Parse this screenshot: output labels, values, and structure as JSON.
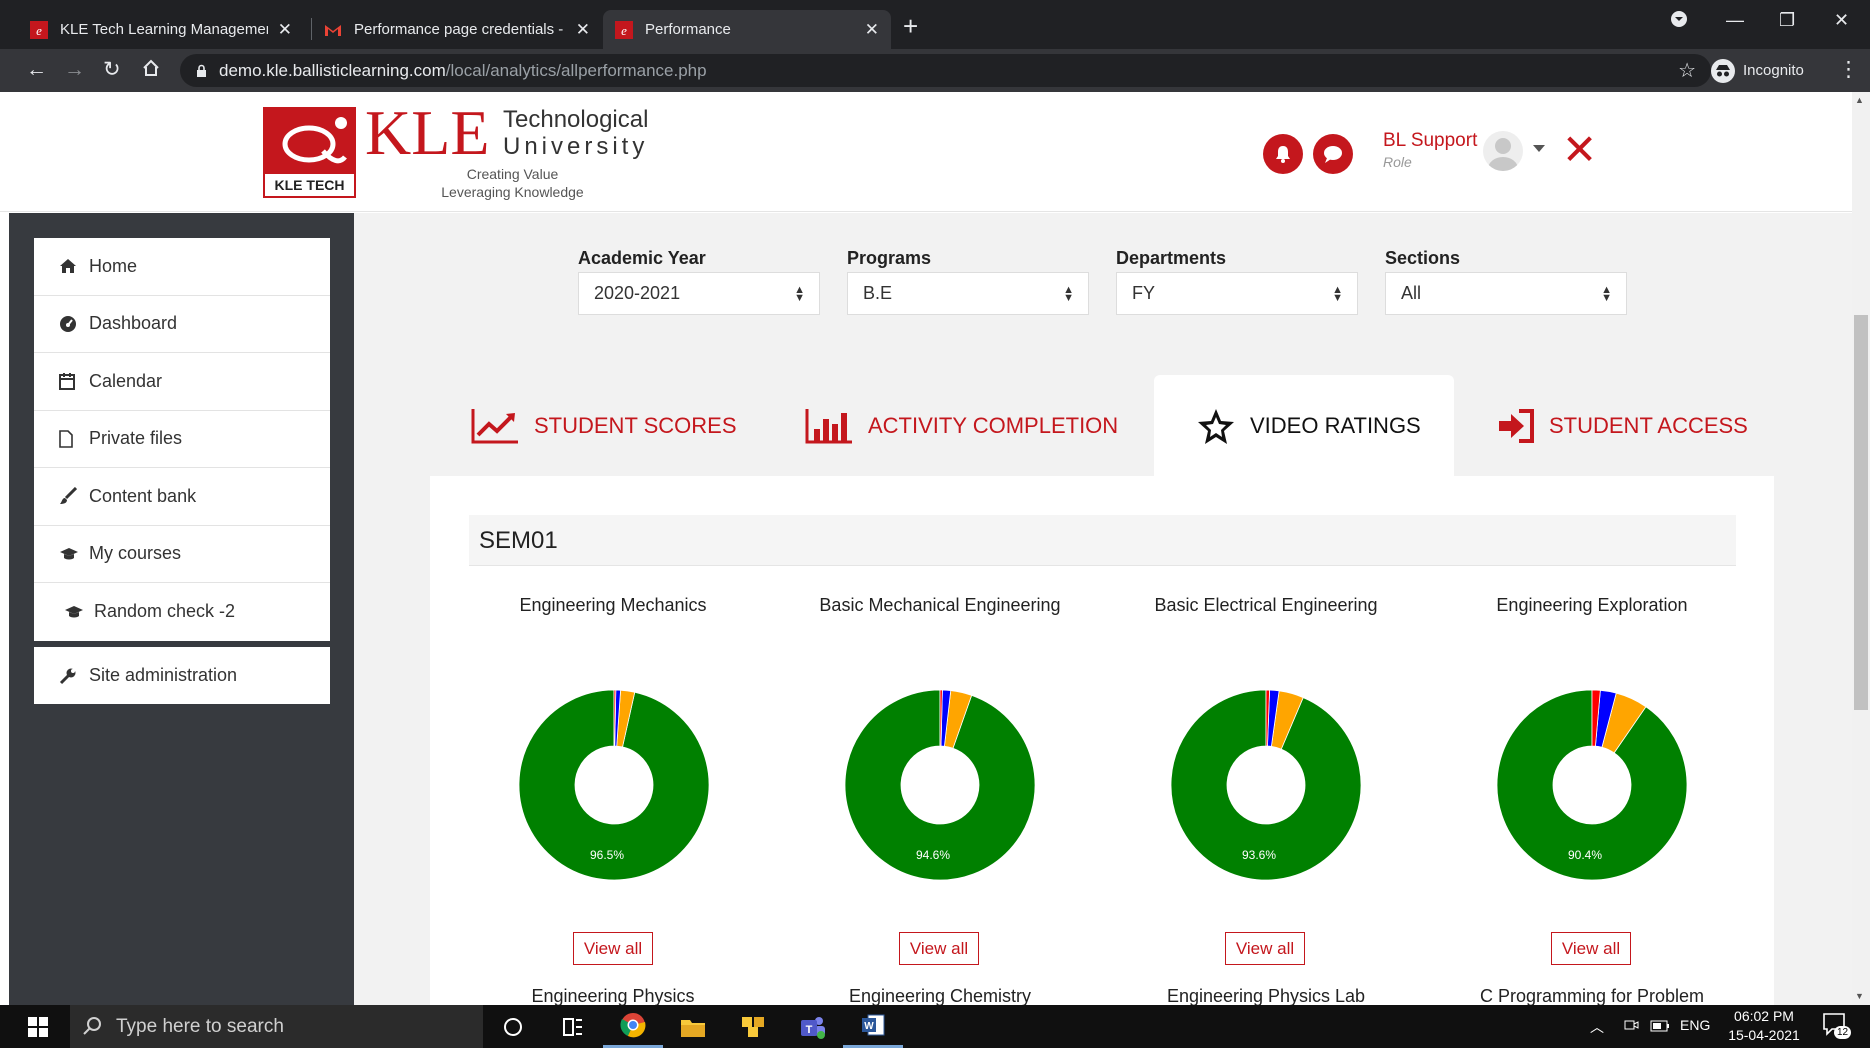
{
  "browser": {
    "tabs": [
      {
        "title": "KLE Tech Learning Management S",
        "active": false
      },
      {
        "title": "Performance page credentials - u",
        "active": false
      },
      {
        "title": "Performance",
        "active": true
      }
    ],
    "url_host": "demo.kle.ballisticlearning.com",
    "url_path": "/local/analytics/allperformance.php",
    "incognito_label": "Incognito"
  },
  "header": {
    "logo_badge": "KLE TECH",
    "logo_kle": "KLE",
    "logo_line1": "Technological",
    "logo_line2": "University",
    "tagline1": "Creating Value",
    "tagline2": "Leveraging Knowledge",
    "user_name": "BL Support",
    "user_role": "Role"
  },
  "sidebar": {
    "items": [
      {
        "label": "Home",
        "icon": "home-icon"
      },
      {
        "label": "Dashboard",
        "icon": "dashboard-icon"
      },
      {
        "label": "Calendar",
        "icon": "calendar-icon"
      },
      {
        "label": "Private files",
        "icon": "file-icon"
      },
      {
        "label": "Content bank",
        "icon": "brush-icon"
      },
      {
        "label": "My courses",
        "icon": "graduation-cap-icon"
      },
      {
        "label": "Random check -2",
        "icon": "graduation-cap-icon"
      }
    ],
    "admin": {
      "label": "Site administration",
      "icon": "wrench-icon"
    }
  },
  "filters": {
    "academic_year": {
      "label": "Academic Year",
      "value": "2020-2021"
    },
    "programs": {
      "label": "Programs",
      "value": "B.E"
    },
    "departments": {
      "label": "Departments",
      "value": "FY"
    },
    "sections": {
      "label": "Sections",
      "value": "All"
    }
  },
  "tabs": [
    {
      "label": "STUDENT SCORES",
      "icon": "line-chart-icon",
      "active": false
    },
    {
      "label": "ACTIVITY COMPLETION",
      "icon": "bar-chart-icon",
      "active": false
    },
    {
      "label": "VIDEO RATINGS",
      "icon": "star-icon",
      "active": true
    },
    {
      "label": "STUDENT ACCESS",
      "icon": "sign-in-icon",
      "active": false
    }
  ],
  "semester": "SEM01",
  "view_all_label": "View all",
  "colors": {
    "accent": "#c4171d",
    "green": "#008000",
    "orange": "#ffa500",
    "blue": "#0000ff",
    "red": "#ff0000",
    "sidebar": "#373a3f"
  },
  "chart_data": [
    {
      "type": "pie",
      "title": "Engineering Mechanics",
      "donut": true,
      "labels": [
        "",
        "",
        "",
        ""
      ],
      "values": [
        96.5,
        2.4,
        0.8,
        0.3
      ],
      "colors": [
        "#008000",
        "#ffa500",
        "#0000ff",
        "#ff0000"
      ],
      "data_labels": [
        "96.5%"
      ]
    },
    {
      "type": "pie",
      "title": "Basic Mechanical Engineering",
      "donut": true,
      "labels": [
        "",
        "",
        "",
        ""
      ],
      "values": [
        94.6,
        3.6,
        1.4,
        0.4
      ],
      "colors": [
        "#008000",
        "#ffa500",
        "#0000ff",
        "#ff0000"
      ],
      "data_labels": [
        "94.6%"
      ]
    },
    {
      "type": "pie",
      "title": "Basic Electrical Engineering",
      "donut": true,
      "labels": [
        "",
        "",
        "",
        ""
      ],
      "values": [
        93.6,
        4.2,
        1.6,
        0.6
      ],
      "colors": [
        "#008000",
        "#ffa500",
        "#0000ff",
        "#ff0000"
      ],
      "data_labels": [
        "93.6%"
      ]
    },
    {
      "type": "pie",
      "title": "Engineering Exploration",
      "donut": true,
      "labels": [
        "",
        "",
        "",
        ""
      ],
      "values": [
        90.4,
        5.5,
        2.7,
        1.4
      ],
      "colors": [
        "#008000",
        "#ffa500",
        "#0000ff",
        "#ff0000"
      ],
      "data_labels": [
        "90.4%"
      ]
    }
  ],
  "next_row_courses": [
    "Engineering Physics",
    "Engineering Chemistry",
    "Engineering Physics Lab",
    "C Programming for Problem"
  ],
  "taskbar": {
    "search_placeholder": "Type here to search",
    "lang": "ENG",
    "time": "06:02 PM",
    "date": "15-04-2021",
    "notification_count": "12"
  }
}
